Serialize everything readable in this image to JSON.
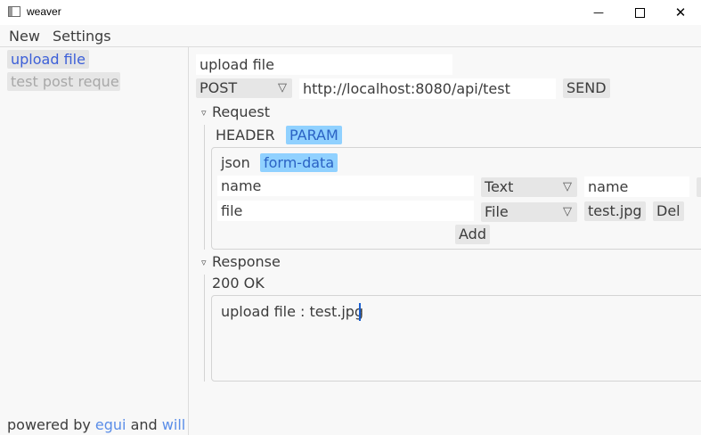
{
  "window": {
    "title": "weaver",
    "minimize_glyph": "—",
    "maximize_glyph": "☐",
    "close_glyph": "✕"
  },
  "menu": {
    "new_label": "New",
    "settings_label": "Settings"
  },
  "sidebar": {
    "items": [
      {
        "label": "upload file"
      },
      {
        "label": "test post reque"
      }
    ],
    "footer": {
      "prefix": "powered by",
      "link1": "egui",
      "joiner": "and",
      "link2": "will"
    }
  },
  "request_bar": {
    "name_value": "upload file",
    "method": "POST",
    "url": "http://localhost:8080/api/test",
    "send_label": "SEND"
  },
  "request_section": {
    "header": "Request",
    "tabs": [
      {
        "label": "HEADER"
      },
      {
        "label": "PARAM"
      }
    ],
    "selected_tab": "PARAM",
    "body_types": [
      {
        "label": "json"
      },
      {
        "label": "form-data"
      }
    ],
    "selected_body_type": "form-data",
    "rows": [
      {
        "key": "name",
        "type": "Text",
        "value": "name"
      },
      {
        "key": "file",
        "type": "File",
        "value": "test.jpg",
        "delete_label": "Del"
      }
    ],
    "add_label": "Add"
  },
  "response_section": {
    "header": "Response",
    "status": "200 OK",
    "body": "upload file : test.jpg"
  },
  "icons": {
    "collapse": "▿",
    "dropdown": "▽"
  },
  "colors": {
    "accent": "#90d1ff",
    "link": "#5a8de8",
    "selected_text": "#3c5fd8"
  }
}
